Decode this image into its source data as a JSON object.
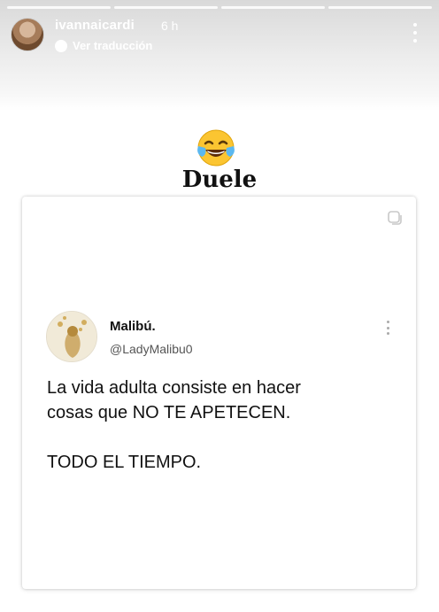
{
  "story": {
    "progress_segments": 4,
    "header": {
      "username": "ivannaicardi",
      "time": "6 h",
      "translate_label": "Ver traducción",
      "icons": {
        "avatar": "profile-photo",
        "translate": "globe-icon",
        "more": "more-vertical-icon"
      }
    },
    "sticker": {
      "emoji_name": "face-with-tears-of-joy-icon",
      "text": "Duele"
    },
    "tweet": {
      "name": "Malibú.",
      "handle": "@LadyMalibu0",
      "lines": [
        "La vida adulta consiste en hacer",
        "cosas que NO TE APETECEN.",
        "",
        "TODO EL TIEMPO."
      ]
    }
  }
}
